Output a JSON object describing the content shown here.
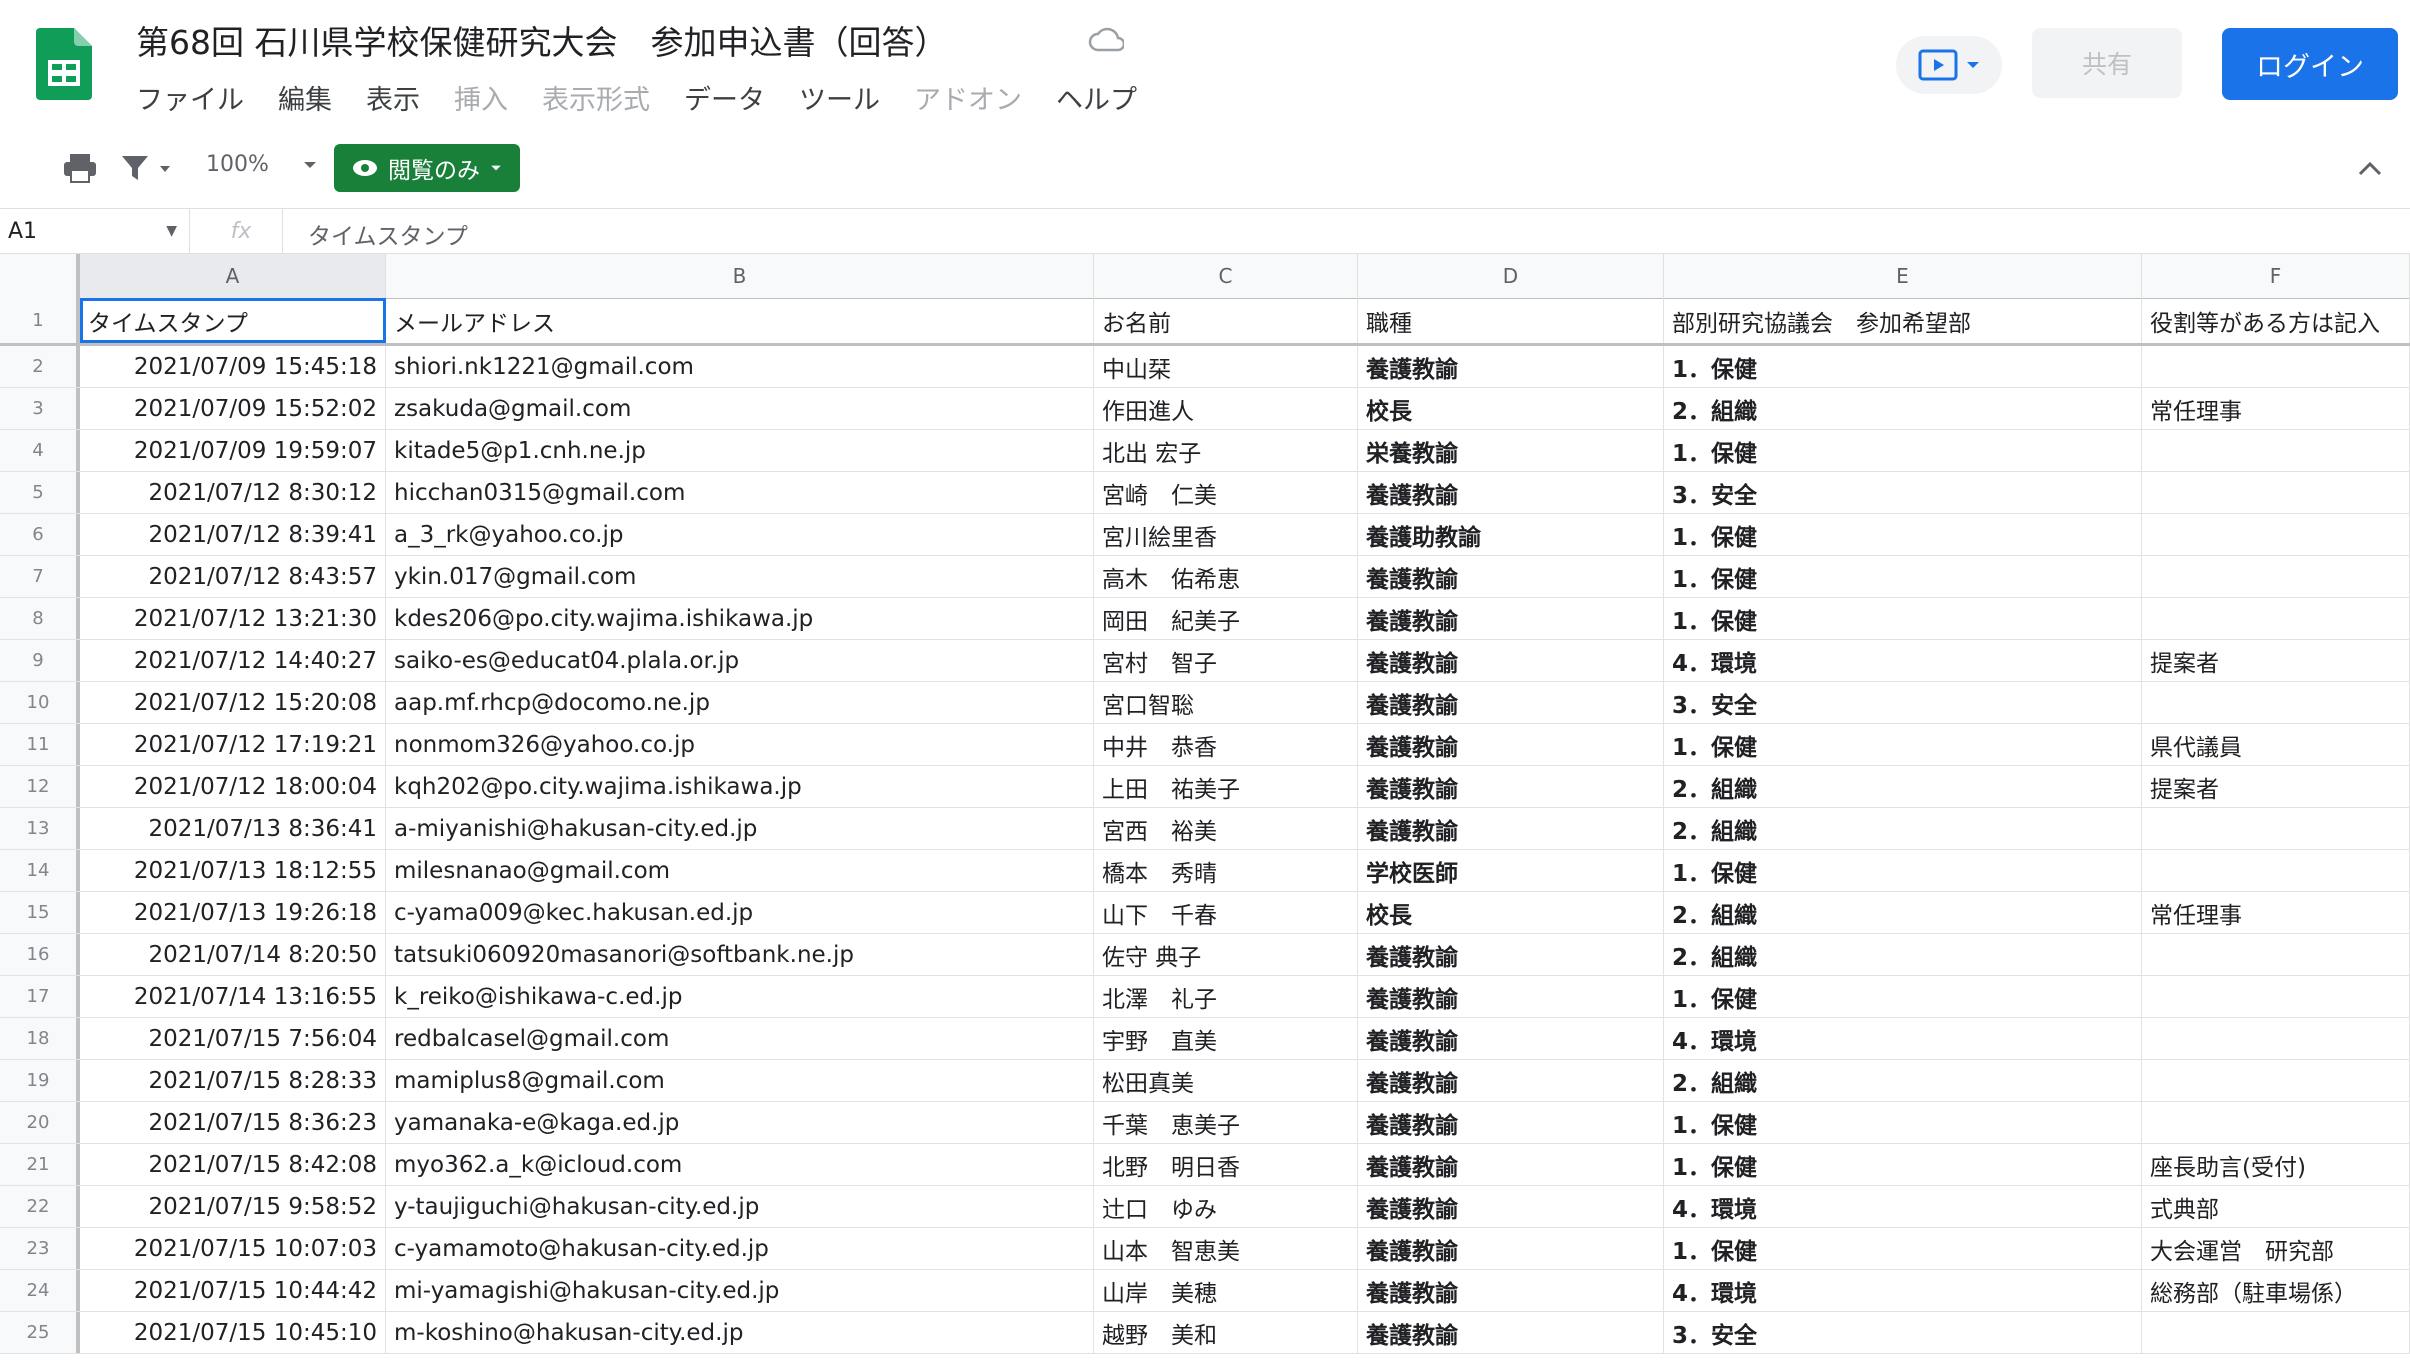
{
  "app": {
    "title": "第68回 石川県学校保健研究大会　参加申込書（回答）",
    "menu": [
      "ファイル",
      "編集",
      "表示",
      "挿入",
      "表示形式",
      "データ",
      "ツール",
      "アドオン",
      "ヘルプ"
    ],
    "menu_dim": [
      false,
      false,
      false,
      true,
      true,
      false,
      false,
      true,
      false
    ],
    "share_label": "共有",
    "login_label": "ログイン",
    "accent": "#1a73e8",
    "brand_green": "#188038"
  },
  "toolbar": {
    "zoom": "100%",
    "view_only_label": "閲覧のみ"
  },
  "formula_bar": {
    "cell_ref": "A1",
    "fx_label": "fx",
    "value": "タイムスタンプ"
  },
  "columns": [
    "A",
    "B",
    "C",
    "D",
    "E",
    "F"
  ],
  "header_row": [
    "タイムスタンプ",
    "メールアドレス",
    "お名前",
    "職種",
    "部別研究協議会　参加希望部",
    "役割等がある方は記入"
  ],
  "rows": [
    [
      "2021/07/09 15:45:18",
      "shiori.nk1221@gmail.com",
      "中山栞",
      "養護教諭",
      "1．保健",
      ""
    ],
    [
      "2021/07/09 15:52:02",
      "zsakuda@gmail.com",
      "作田進人",
      "校長",
      "2．組織",
      "常任理事"
    ],
    [
      "2021/07/09 19:59:07",
      "kitade5@p1.cnh.ne.jp",
      "北出 宏子",
      "栄養教諭",
      "1．保健",
      ""
    ],
    [
      "2021/07/12 8:30:12",
      "hicchan0315@gmail.com",
      "宮崎　仁美",
      "養護教諭",
      "3．安全",
      ""
    ],
    [
      "2021/07/12 8:39:41",
      "a_3_rk@yahoo.co.jp",
      "宮川絵里香",
      "養護助教諭",
      "1．保健",
      ""
    ],
    [
      "2021/07/12 8:43:57",
      "ykin.017@gmail.com",
      "高木　佑希恵",
      "養護教諭",
      "1．保健",
      ""
    ],
    [
      "2021/07/12 13:21:30",
      "kdes206@po.city.wajima.ishikawa.jp",
      "岡田　紀美子",
      "養護教諭",
      "1．保健",
      ""
    ],
    [
      "2021/07/12 14:40:27",
      "saiko-es@educat04.plala.or.jp",
      "宮村　智子",
      "養護教諭",
      "4．環境",
      "提案者"
    ],
    [
      "2021/07/12 15:20:08",
      "aap.mf.rhcp@docomo.ne.jp",
      "宮口智聡",
      "養護教諭",
      "3．安全",
      ""
    ],
    [
      "2021/07/12 17:19:21",
      "nonmom326@yahoo.co.jp",
      "中井　恭香",
      "養護教諭",
      "1．保健",
      "県代議員"
    ],
    [
      "2021/07/12 18:00:04",
      "kqh202@po.city.wajima.ishikawa.jp",
      "上田　祐美子",
      "養護教諭",
      "2．組織",
      "提案者"
    ],
    [
      "2021/07/13 8:36:41",
      "a-miyanishi@hakusan-city.ed.jp",
      "宮西　裕美",
      "養護教諭",
      "2．組織",
      ""
    ],
    [
      "2021/07/13 18:12:55",
      "milesnanao@gmail.com",
      "橋本　秀晴",
      "学校医師",
      "1．保健",
      ""
    ],
    [
      "2021/07/13 19:26:18",
      "c-yama009@kec.hakusan.ed.jp",
      "山下　千春",
      "校長",
      "2．組織",
      "常任理事"
    ],
    [
      "2021/07/14 8:20:50",
      "tatsuki060920masanori@softbank.ne.jp",
      "佐守 典子",
      "養護教諭",
      "2．組織",
      ""
    ],
    [
      "2021/07/14 13:16:55",
      "k_reiko@ishikawa-c.ed.jp",
      "北澤　礼子",
      "養護教諭",
      "1．保健",
      ""
    ],
    [
      "2021/07/15 7:56:04",
      "redbalcasel@gmail.com",
      "宇野　直美",
      "養護教諭",
      "4．環境",
      ""
    ],
    [
      "2021/07/15 8:28:33",
      "mamiplus8@gmail.com",
      "松田真美",
      "養護教諭",
      "2．組織",
      ""
    ],
    [
      "2021/07/15 8:36:23",
      "yamanaka-e@kaga.ed.jp",
      "千葉　恵美子",
      "養護教諭",
      "1．保健",
      ""
    ],
    [
      "2021/07/15 8:42:08",
      "myo362.a_k@icloud.com",
      "北野　明日香",
      "養護教諭",
      "1．保健",
      "座長助言(受付)"
    ],
    [
      "2021/07/15 9:58:52",
      "y-taujiguchi@hakusan-city.ed.jp",
      "辻口　ゆみ",
      "養護教諭",
      "4．環境",
      "式典部"
    ],
    [
      "2021/07/15 10:07:03",
      "c-yamamoto@hakusan-city.ed.jp",
      "山本　智恵美",
      "養護教諭",
      "1．保健",
      "大会運営　研究部"
    ],
    [
      "2021/07/15 10:44:42",
      "mi-yamagishi@hakusan-city.ed.jp",
      "山岸　美穂",
      "養護教諭",
      "4．環境",
      "総務部（駐車場係）"
    ],
    [
      "2021/07/15 10:45:10",
      "m-koshino@hakusan-city.ed.jp",
      "越野　美和",
      "養護教諭",
      "3．安全",
      ""
    ]
  ]
}
